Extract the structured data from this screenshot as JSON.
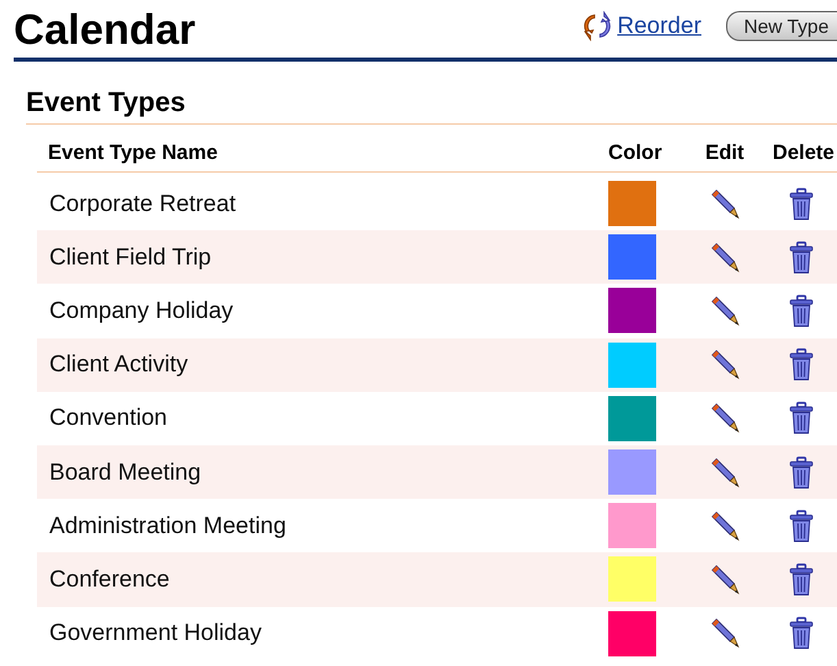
{
  "page_title": "Calendar",
  "reorder_link": "Reorder",
  "new_type_button": "New Type",
  "section_title": "Event Types",
  "columns": [
    "Event Type Name",
    "Color",
    "Edit",
    "Delete"
  ],
  "rows": [
    {
      "name": "Corporate Retreat",
      "color": "#e07010"
    },
    {
      "name": "Client Field Trip",
      "color": "#3366ff"
    },
    {
      "name": "Company Holiday",
      "color": "#990099"
    },
    {
      "name": "Client Activity",
      "color": "#00ccff"
    },
    {
      "name": "Convention",
      "color": "#009999"
    },
    {
      "name": "Board Meeting",
      "color": "#9999ff"
    },
    {
      "name": "Administration Meeting",
      "color": "#ff99cc"
    },
    {
      "name": "Conference",
      "color": "#ffff66"
    },
    {
      "name": "Government Holiday",
      "color": "#ff0066"
    }
  ]
}
